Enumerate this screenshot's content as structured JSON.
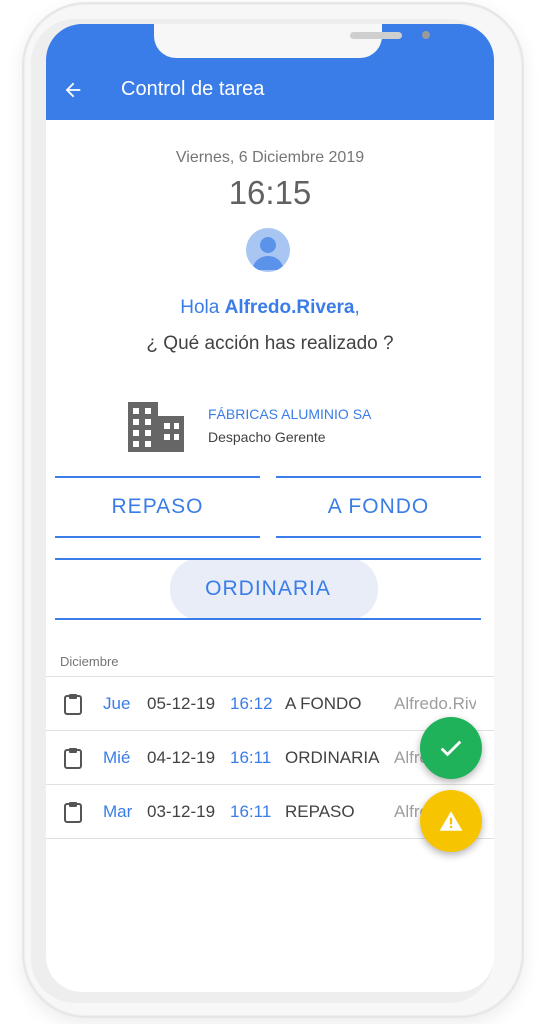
{
  "appbar": {
    "title": "Control de tarea",
    "color": "#3a7de8"
  },
  "header": {
    "date": "Viernes, 6 Diciembre 2019",
    "time": "16:15",
    "greeting_prefix": "Hola ",
    "user_name": "Alfredo.Rivera",
    "greeting_suffix": ",",
    "question": "¿ Qué acción has realizado ?"
  },
  "location": {
    "company": "FÁBRICAS ALUMINIO SA",
    "place": "Despacho Gerente"
  },
  "actions": {
    "repaso": "REPASO",
    "a_fondo": "A FONDO",
    "ordinaria": "ORDINARIA"
  },
  "history": {
    "section_label": "Diciembre",
    "rows": [
      {
        "day": "Jue",
        "date": "05-12-19",
        "time": "16:12",
        "type": "A FONDO",
        "user": "Alfredo.Rivera"
      },
      {
        "day": "Mié",
        "date": "04-12-19",
        "time": "16:11",
        "type": "ORDINARIA",
        "user": "Alfredo.Rivera"
      },
      {
        "day": "Mar",
        "date": "03-12-19",
        "time": "16:11",
        "type": "REPASO",
        "user": "Alfredo.Rivera"
      }
    ]
  },
  "fabs": {
    "confirm": {
      "icon": "check-icon",
      "color": "#1fb25a"
    },
    "incident": {
      "icon": "warning-icon",
      "color": "#f6c400"
    }
  }
}
